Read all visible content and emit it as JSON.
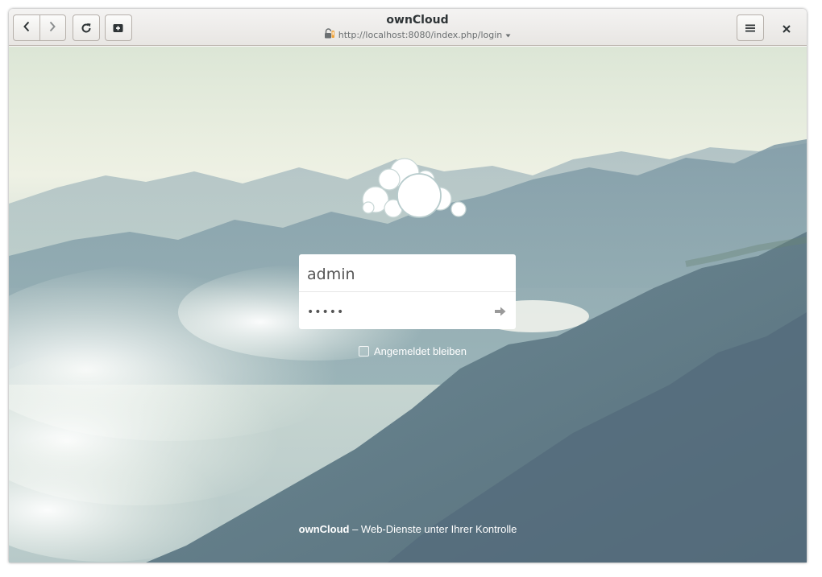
{
  "browser": {
    "title": "ownCloud",
    "url": "http://localhost:8080/index.php/login",
    "icons": {
      "back": "chevron-left-icon",
      "forward": "chevron-right-icon",
      "reload": "reload-icon",
      "new_tab": "new-tab-icon",
      "security": "insecure-lock-icon",
      "url_dropdown": "caret-down-icon",
      "menu": "hamburger-menu-icon",
      "close": "close-icon"
    }
  },
  "login": {
    "username": "admin",
    "password": "•••••",
    "remember_label": "Angemeldet bleiben",
    "submit_icon": "arrow-right-icon"
  },
  "footer": {
    "brand": "ownCloud",
    "tagline": " – Web-Dienste unter Ihrer Kontrolle"
  },
  "colors": {
    "headerbar": "#ebe9e6",
    "login_box": "#ffffff",
    "footer_text": "#ffffff"
  }
}
